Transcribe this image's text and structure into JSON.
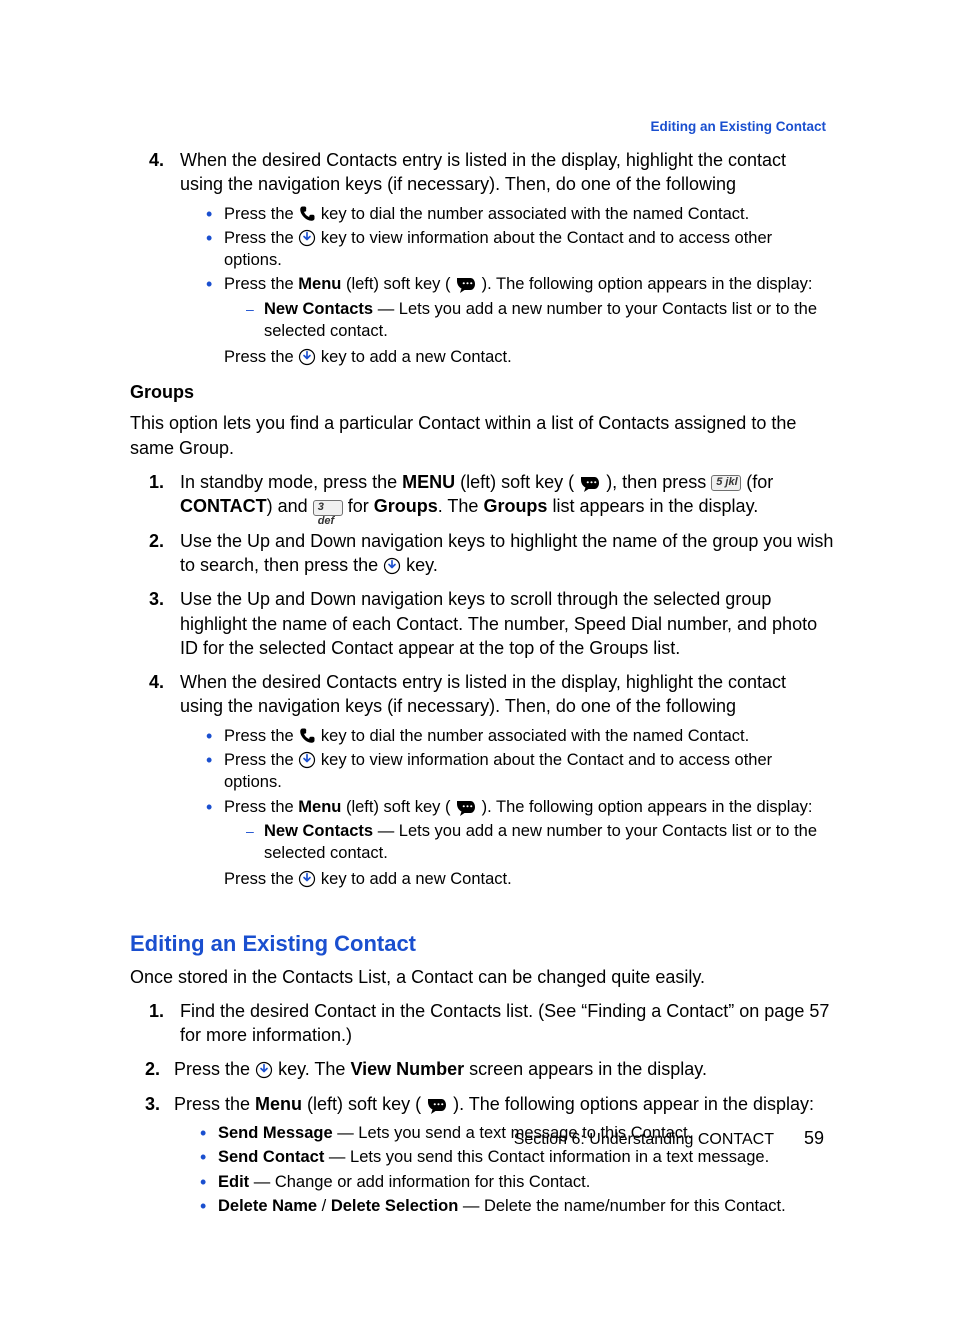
{
  "running_head": "Editing an Existing Contact",
  "block1": {
    "num4": "4.",
    "step4_text_a": "When the desired Contacts entry is listed in the display, highlight the contact using the navigation keys (if necessary). Then, do one of the following",
    "b1_a": "Press the ",
    "b1_b": " key to dial the number associated with the named Contact.",
    "b2_a": "Press the ",
    "b2_b": " key to view information about the Contact and to access other options.",
    "b3_a": "Press the ",
    "b3_menu": "Menu",
    "b3_b": " (left) soft key ( ",
    "b3_c": " ). The following option appears in the display:",
    "sub_dash_bold": "New Contacts",
    "sub_dash_rest": " — Lets you add a new number to your Contacts list or to the selected contact.",
    "after_sub_a": "Press the ",
    "after_sub_b": " key to add a new Contact."
  },
  "groups": {
    "heading": "Groups",
    "intro": "This option lets you find a particular Contact within a list of Contacts assigned to the same Group.",
    "num1": "1.",
    "s1_a": "In standby mode, press the ",
    "s1_menu": "MENU",
    "s1_b": " (left) soft key ( ",
    "s1_c": " ), then press ",
    "s1_d": " (for ",
    "s1_contact": "CONTACT",
    "s1_e": ") and ",
    "s1_f": " for ",
    "s1_groups": "Groups",
    "s1_g": ". The ",
    "s1_groups2": "Groups",
    "s1_h": " list appears in the display.",
    "num2": "2.",
    "s2_a": "Use the Up and Down navigation keys to highlight the name of the group you wish to search, then press the ",
    "s2_b": " key.",
    "num3": "3.",
    "s3": "Use the Up and Down navigation keys to scroll through the selected group highlight the name of each Contact. The number, Speed Dial number, and photo ID for the selected Contact appear at the top of the Groups list.",
    "num4": "4.",
    "s4": "When the desired Contacts entry is listed in the display, highlight the contact using the navigation keys (if necessary). Then, do one of the following"
  },
  "editing": {
    "heading": "Editing an Existing Contact",
    "intro": "Once stored in the Contacts List, a Contact can be changed quite easily.",
    "num1": "1.",
    "s1": "Find the desired Contact in the Contacts list. (See “Finding a Contact” on page 57 for more information.)",
    "num2": "2.",
    "s2_a": "Press the ",
    "s2_b": " key. The ",
    "s2_view": "View Number",
    "s2_c": " screen appears in the display.",
    "num3": "3.",
    "s3_a": "Press the ",
    "s3_menu": "Menu",
    "s3_b": " (left) soft key ( ",
    "s3_c": " ). The following options appear in the display:",
    "opt1_b": "Send Message",
    "opt1_r": " — Lets you send a text message to this Contact.",
    "opt2_b": "Send Contact",
    "opt2_r": " — Lets you send this Contact information in a text message.",
    "opt3_b": "Edit",
    "opt3_r": " — Change or add information for this Contact.",
    "opt4_b1": "Delete Name",
    "opt4_sep": " / ",
    "opt4_b2": "Delete Selection",
    "opt4_r": " — Delete the name/number for this Contact."
  },
  "footer": {
    "section": "Section 6: Understanding CONTACT",
    "page": "59"
  }
}
